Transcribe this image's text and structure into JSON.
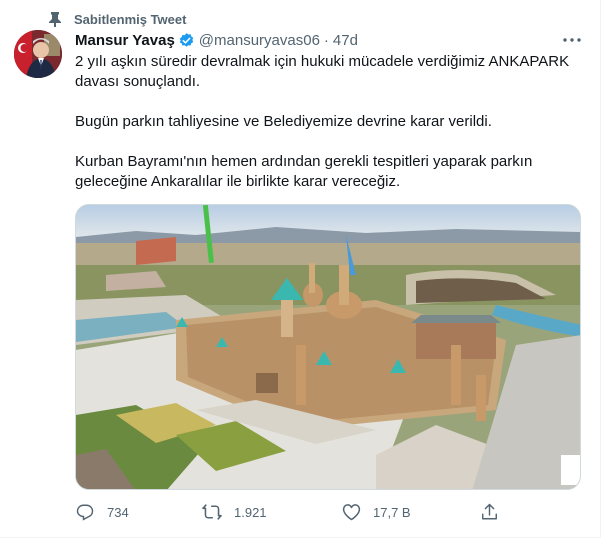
{
  "pinned": {
    "label": "Sabitlenmiş Tweet",
    "icon": "pin-icon"
  },
  "author": {
    "name": "Mansur Yavaş",
    "handle": "@mansuryavas06",
    "separator": "·",
    "time": "47d",
    "verified_icon": "verified-badge-icon",
    "avatar_icon": "avatar"
  },
  "tweet": {
    "paragraphs": [
      "2 yılı aşkın süredir devralmak için hukuki mücadele verdiğimiz ANKAPARK davası sonuçlandı.",
      "Bugün parkın tahliyesine ve Belediyemize devrine karar verildi.",
      "Kurban Bayramı'nın hemen ardından gerekli tespitleri yaparak parkın geleceğine Ankaralılar ile birlikte karar vereceğiz."
    ]
  },
  "actions": {
    "reply": {
      "count": "734",
      "icon": "reply-icon"
    },
    "retweet": {
      "count": "1.921",
      "icon": "retweet-icon"
    },
    "like": {
      "count": "17,7 B",
      "icon": "like-icon"
    },
    "share": {
      "icon": "share-icon"
    }
  },
  "colors": {
    "verified": "#1d9bf0",
    "secondary_text": "#536471",
    "primary_text": "#0f1419"
  }
}
